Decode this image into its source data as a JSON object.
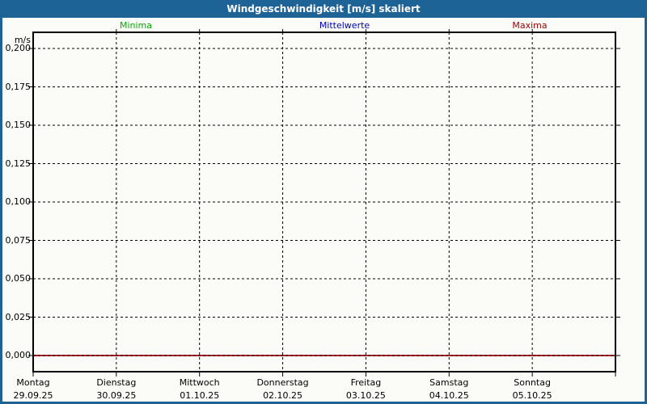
{
  "window": {
    "title": "Windgeschwindigkeit [m/s] skaliert"
  },
  "colors": {
    "titlebar_bg": "#1E6396",
    "titlebar_text": "#FFFFFF",
    "frame": "#1E6396",
    "content_bg": "#FBFCF7",
    "axis": "#000000",
    "grid": "#000000",
    "minima_label": "#00AA00",
    "mittelwerte_label": "#0000BB",
    "maxima_label": "#990000",
    "zero_line_red": "#DD0000"
  },
  "legend": {
    "items": [
      {
        "label": "Minima",
        "color": "#00AA00"
      },
      {
        "label": "Mittelwerte",
        "color": "#0000BB"
      },
      {
        "label": "Maxima",
        "color": "#990000"
      }
    ]
  },
  "chart_data": {
    "type": "line",
    "title": "Windgeschwindigkeit [m/s] skaliert",
    "ylabel": "m/s",
    "xlabel": "",
    "ylim": [
      0,
      0.2
    ],
    "ytick_step": 0.025,
    "grid": true,
    "legend_position": "top",
    "yticks": [
      {
        "label": "0,200",
        "value": 0.2
      },
      {
        "label": "0,175",
        "value": 0.175
      },
      {
        "label": "0,150",
        "value": 0.15
      },
      {
        "label": "0,125",
        "value": 0.125
      },
      {
        "label": "0,100",
        "value": 0.1
      },
      {
        "label": "0,075",
        "value": 0.075
      },
      {
        "label": "0,050",
        "value": 0.05
      },
      {
        "label": "0,025",
        "value": 0.025
      },
      {
        "label": "0,000",
        "value": 0.0
      }
    ],
    "categories": [
      {
        "day": "Montag",
        "date": "29.09.25"
      },
      {
        "day": "Dienstag",
        "date": "30.09.25"
      },
      {
        "day": "Mittwoch",
        "date": "01.10.25"
      },
      {
        "day": "Donnerstag",
        "date": "02.10.25"
      },
      {
        "day": "Freitag",
        "date": "03.10.25"
      },
      {
        "day": "Samstag",
        "date": "04.10.25"
      },
      {
        "day": "Sonntag",
        "date": "05.10.25"
      }
    ],
    "series": [
      {
        "name": "Minima",
        "color": "#00AA00",
        "values": [
          0,
          0,
          0,
          0,
          0,
          0,
          0
        ]
      },
      {
        "name": "Mittelwerte",
        "color": "#0000BB",
        "values": [
          0,
          0,
          0,
          0,
          0,
          0,
          0
        ]
      },
      {
        "name": "Maxima",
        "color": "#DD0000",
        "values": [
          0,
          0,
          0,
          0,
          0,
          0,
          0
        ]
      }
    ]
  }
}
